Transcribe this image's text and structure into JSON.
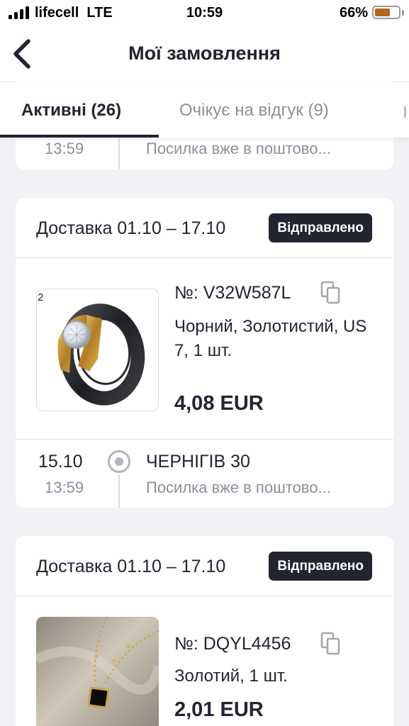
{
  "status_bar": {
    "carrier": "lifecell  LTE",
    "time": "10:59",
    "battery_percent": "66%",
    "battery_level": 0.66,
    "battery_color": "#b5651d"
  },
  "nav": {
    "title": "Мої замовлення",
    "back_icon": "chevron-left-icon"
  },
  "tabs": [
    {
      "label": "Активні (26)",
      "active": true
    },
    {
      "label": "Очікує на відгук (9)",
      "active": false
    }
  ],
  "orders": [
    {
      "tracking": {
        "time": "13:59",
        "status": "Посилка вже в поштово..."
      }
    },
    {
      "delivery": "Доставка 01.10 – 17.10",
      "status": "Відправлено",
      "photo_tag": "2",
      "image": "black-gold-ring-photo",
      "number": "№: V32W587L",
      "copy_icon": "copy-icon",
      "variant": "Чорний, Золотистий, US 7, 1 шт.",
      "price": "4,08 EUR",
      "tracking": {
        "date": "15.10",
        "time": "13:59",
        "place": "ЧЕРНІГІВ 30",
        "status": "Посилка вже в поштово..."
      }
    },
    {
      "delivery": "Доставка 01.10 – 17.10",
      "status": "Відправлено",
      "image": "gold-chain-pendant-necklace-photo",
      "number": "№: DQYL4456",
      "copy_icon": "copy-icon",
      "variant": "Золотий, 1 шт.",
      "price": "2,01 EUR"
    }
  ],
  "colors": {
    "background": "#f1f2f5",
    "primary_text": "#222430",
    "secondary_text": "#8c8f98",
    "badge_background": "#222430"
  }
}
